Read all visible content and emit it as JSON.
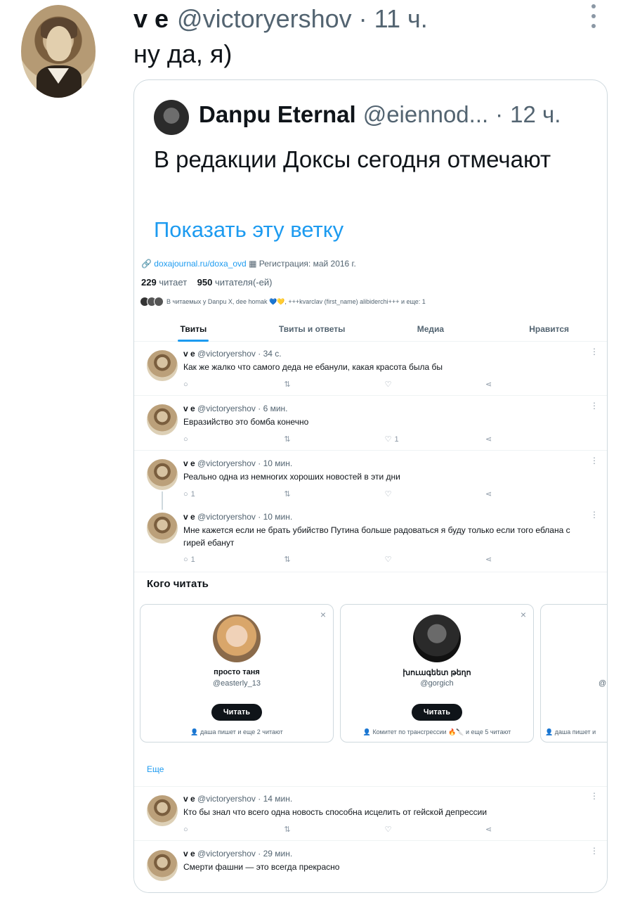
{
  "outer_tweet": {
    "name": "v e",
    "handle": "@victoryershov",
    "separator": "·",
    "time": "11 ч.",
    "text": "ну да, я)"
  },
  "quote": {
    "name": "Danpu Eternal",
    "handle": "@eiennod...",
    "separator": "·",
    "time": "12 ч.",
    "text": "В редакции Доксы сегодня отмечают",
    "show_thread": "Показать эту ветку"
  },
  "profile": {
    "link": "doxajournal.ru/doxa_ovd",
    "registered": "Регистрация: май 2016 г.",
    "following_count": "229",
    "following_label": "читает",
    "followers_count": "950",
    "followers_label": "читателя(-ей)",
    "followed_by": "В читаемых у Danpu X, dee homak 💙💛, +++kvarclav (first_name) alibiderchi+++ и еще: 1",
    "tabs": [
      "Твиты",
      "Твиты и ответы",
      "Медиа",
      "Нравится"
    ]
  },
  "tweets": [
    {
      "name": "v e",
      "meta": "@victoryershov · 34 с.",
      "text": "Как же жалко что самого деда не ебанули, какая красота была бы",
      "reply": "",
      "like": ""
    },
    {
      "name": "v e",
      "meta": "@victoryershov · 6 мин.",
      "text": "Евразийство это бомба конечно",
      "reply": "",
      "like": "1"
    },
    {
      "name": "v e",
      "meta": "@victoryershov · 10 мин.",
      "text": "Реально одна из немногих хороших новостей в эти дни",
      "reply": "1",
      "like": ""
    },
    {
      "name": "v e",
      "meta": "@victoryershov · 10 мин.",
      "text": "Мне кажется если не брать убийство Путина больше радоваться я буду только если того еблана с гирей ебанут",
      "reply": "1",
      "like": ""
    },
    {
      "name": "v e",
      "meta": "@victoryershov · 14 мин.",
      "text": "Кто бы знал что всего одна новость способна исцелить от гейской депрессии",
      "reply": "",
      "like": ""
    },
    {
      "name": "v e",
      "meta": "@victoryershov · 29 мин.",
      "text": "Смерти фашни — это всегда прекрасно",
      "reply": "",
      "like": ""
    }
  ],
  "who_to_follow": {
    "title": "Кого читать",
    "follow_label": "Читать",
    "more": "Еще",
    "cards": [
      {
        "name": "просто таня",
        "handle": "@easterly_13",
        "foot": "даша пишет и еще 2 читают"
      },
      {
        "name": "խուագեետ թեղո",
        "handle": "@gorgich",
        "foot": "Комитет по трансгрессии 🔥🔪 и еще 5 читают"
      },
      {
        "name": "",
        "handle": "@",
        "foot": "даша пишет и"
      }
    ]
  },
  "colors": {
    "accent": "#1d9bf0",
    "text": "#0f1419",
    "muted": "#536471",
    "border": "#cfd9de"
  }
}
